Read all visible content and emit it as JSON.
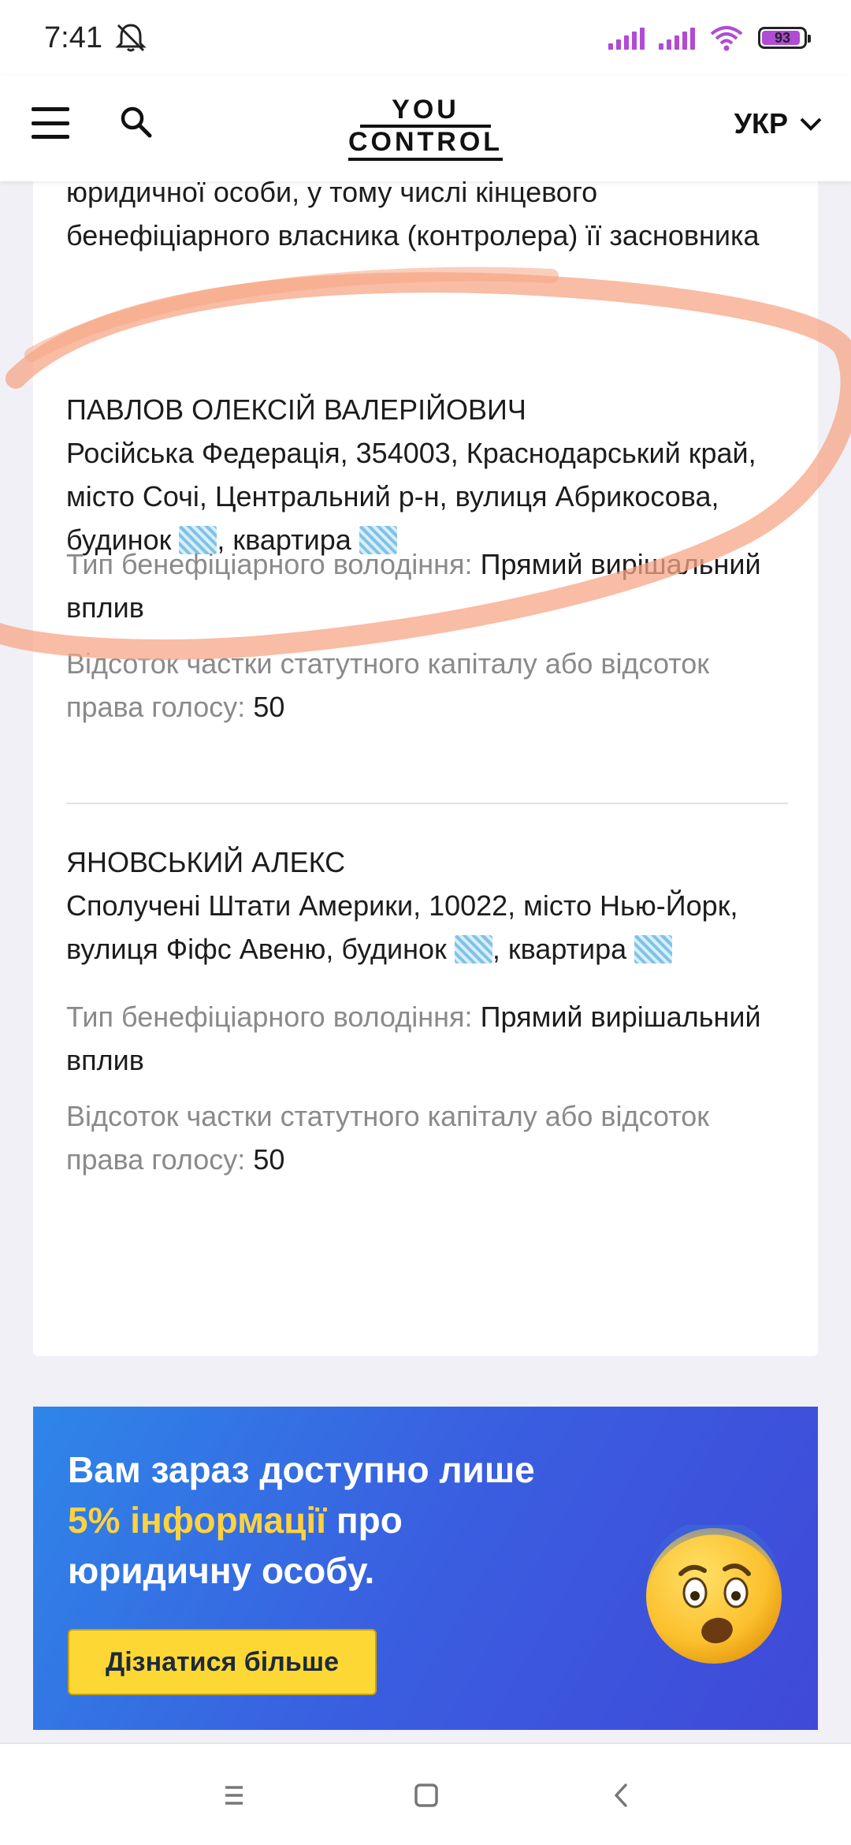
{
  "status_bar": {
    "time": "7:41",
    "battery": "93"
  },
  "header": {
    "logo_top": "YOU",
    "logo_bottom": "CONTROL",
    "language": "УКР"
  },
  "card": {
    "top_text": "юридичної особи, у тому числі кінцевого бенефіціарного власника (контролера) її засновника",
    "beneficiaries": [
      {
        "name": "ПАВЛОВ ОЛЕКСІЙ ВАЛЕРІЙОВИЧ",
        "address_main": "Російська Федерація, 354003, Краснодарський край, місто Сочі, Центральний р-н, вулиця Абрикосова, будинок",
        "address_sep": ", квартира",
        "ownership_label": "Тип бенефіціарного володіння:",
        "ownership_value": "Прямий вирішальний вплив",
        "share_label": "Відсоток частки статутного капіталу або відсоток права голосу:",
        "share_value": "50"
      },
      {
        "name": "ЯНОВСЬКИЙ АЛЕКС",
        "address_main": "Сполучені Штати Америки, 10022, місто Нью-Йорк, вулиця Фіфс Авеню, будинок",
        "address_sep": ", квартира",
        "ownership_label": "Тип бенефіціарного володіння:",
        "ownership_value": "Прямий вирішальний вплив",
        "share_label": "Відсоток частки статутного капіталу або відсоток права голосу:",
        "share_value": "50"
      }
    ]
  },
  "promo": {
    "line1": "Вам зараз доступно лише",
    "accent": "5% інформації",
    "line2_rest": "про",
    "line3": "юридичну особу.",
    "button": "Дізнатися більше"
  },
  "colors": {
    "accent_yellow": "#ffd23f",
    "highlight": "#f7a585",
    "status_purple": "#b04bd6"
  }
}
